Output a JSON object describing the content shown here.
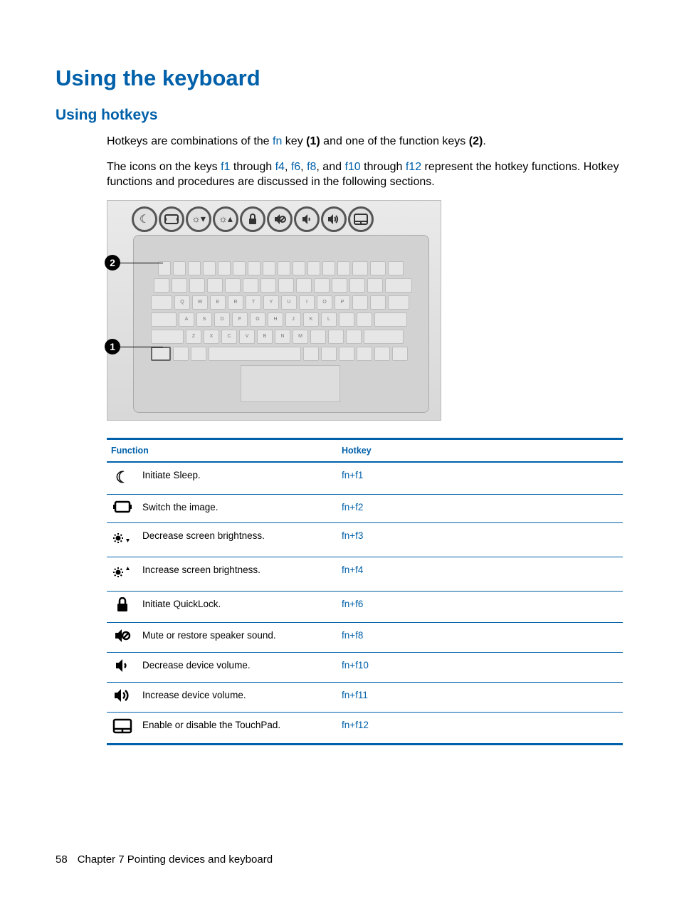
{
  "headings": {
    "main": "Using the keyboard",
    "sub": "Using hotkeys"
  },
  "paragraphs": {
    "p1_pre": "Hotkeys are combinations of the ",
    "p1_fn": "fn",
    "p1_mid": " key ",
    "p1_b1": "(1)",
    "p1_mid2": " and one of the function keys ",
    "p1_b2": "(2)",
    "p1_end": ".",
    "p2_pre": "The icons on the keys ",
    "p2_f1": "f1",
    "p2_mid1": " through ",
    "p2_f4": "f4",
    "p2_c1": ", ",
    "p2_f6": "f6",
    "p2_c2": ", ",
    "p2_f8": "f8",
    "p2_c3": ", and ",
    "p2_f10": "f10",
    "p2_mid2": " through ",
    "p2_f12": "f12",
    "p2_end": " represent the hotkey functions. Hotkey functions and procedures are discussed in the following sections."
  },
  "callouts": {
    "one": "1",
    "two": "2"
  },
  "table": {
    "headers": {
      "func": "Function",
      "hotkey": "Hotkey"
    },
    "rows": [
      {
        "icon": "sleep",
        "func": "Initiate Sleep.",
        "hotkey": "fn+f1"
      },
      {
        "icon": "switch",
        "func": "Switch the image.",
        "hotkey": "fn+f2"
      },
      {
        "icon": "bright-down",
        "func": "Decrease screen brightness.",
        "hotkey": "fn+f3"
      },
      {
        "icon": "bright-up",
        "func": "Increase screen brightness.",
        "hotkey": "fn+f4"
      },
      {
        "icon": "lock",
        "func": "Initiate QuickLock.",
        "hotkey": "fn+f6"
      },
      {
        "icon": "mute",
        "func": "Mute or restore speaker sound.",
        "hotkey": "fn+f8"
      },
      {
        "icon": "vol-down",
        "func": "Decrease device volume.",
        "hotkey": "fn+f10"
      },
      {
        "icon": "vol-up",
        "func": "Increase device volume.",
        "hotkey": "fn+f11"
      },
      {
        "icon": "touchpad",
        "func": "Enable or disable the TouchPad.",
        "hotkey": "fn+f12"
      }
    ]
  },
  "footer": {
    "page_num": "58",
    "chapter": "Chapter 7   Pointing devices and keyboard"
  }
}
